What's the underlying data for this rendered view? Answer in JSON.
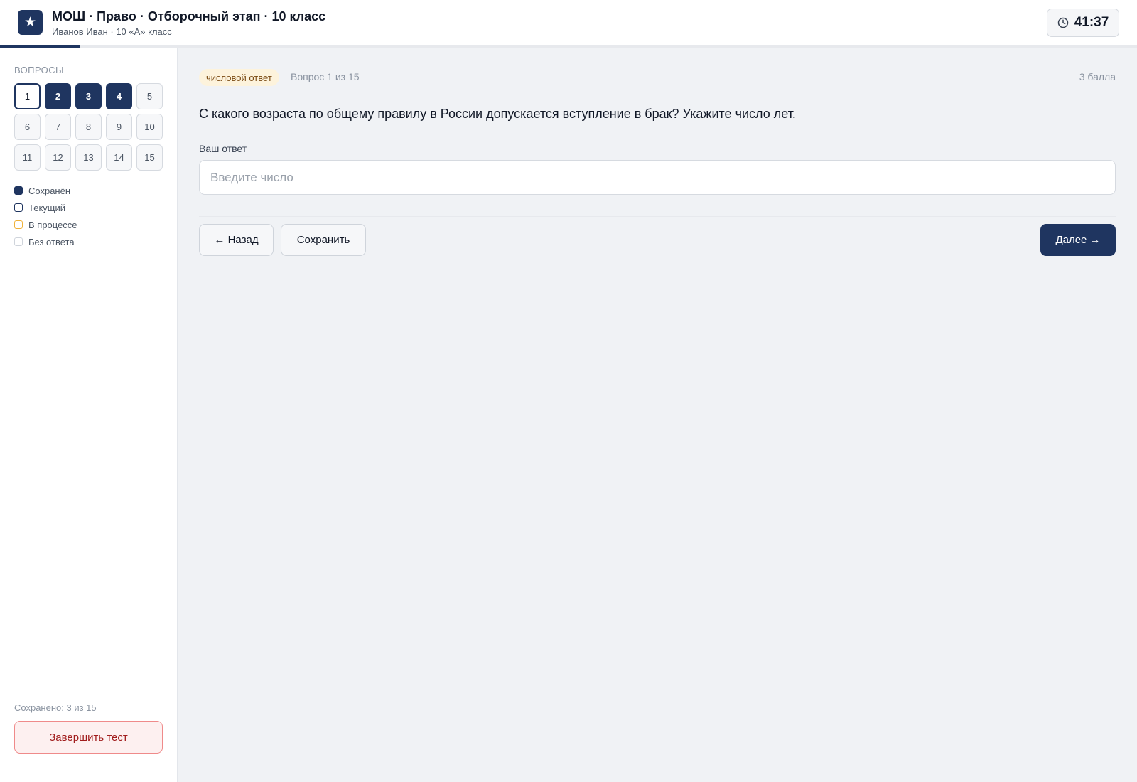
{
  "header": {
    "logo_icon": "star-icon",
    "title": "МОШ · Право · Отборочный этап · 10 класс",
    "subtitle": "Иванов Иван · 10 «А» класс",
    "timer": "41:37",
    "progress_fraction": 0.07
  },
  "sidebar": {
    "heading": "ВОПРОСЫ",
    "questions": [
      {
        "label": "1",
        "state": "current"
      },
      {
        "label": "2",
        "state": "saved"
      },
      {
        "label": "3",
        "state": "saved"
      },
      {
        "label": "4",
        "state": "saved"
      },
      {
        "label": "5",
        "state": "empty"
      },
      {
        "label": "6",
        "state": "empty"
      },
      {
        "label": "7",
        "state": "empty"
      },
      {
        "label": "8",
        "state": "empty"
      },
      {
        "label": "9",
        "state": "empty"
      },
      {
        "label": "10",
        "state": "empty"
      },
      {
        "label": "11",
        "state": "empty"
      },
      {
        "label": "12",
        "state": "empty"
      },
      {
        "label": "13",
        "state": "empty"
      },
      {
        "label": "14",
        "state": "empty"
      },
      {
        "label": "15",
        "state": "empty"
      }
    ],
    "legend": [
      {
        "label": "Сохранён",
        "kind": "saved"
      },
      {
        "label": "Текущий",
        "kind": "current"
      },
      {
        "label": "В процессе",
        "kind": "progress"
      },
      {
        "label": "Без ответа",
        "kind": "empty"
      }
    ],
    "saved_count": "Сохранено: 3 из 15",
    "finish_label": "Завершить тест"
  },
  "main": {
    "tag": "числовой ответ",
    "counter": "Вопрос 1 из 15",
    "points": "3 балла",
    "question": "С какого возраста по общему правилу в России допускается вступление в брак? Укажите число лет.",
    "answer_label": "Ваш ответ",
    "answer_value": "",
    "answer_placeholder": "Введите число",
    "back_label": "← Назад",
    "save_label": "Сохранить",
    "next_label": "Далее →"
  },
  "colors": {
    "brand": "#1f3560",
    "in_progress": "#f0b23a",
    "danger": "#a11d1d",
    "tag_bg": "#fdf3dc"
  }
}
